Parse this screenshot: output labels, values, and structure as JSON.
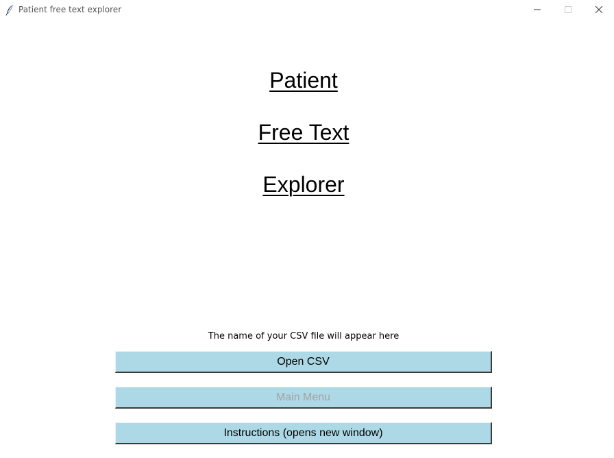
{
  "window": {
    "title": "Patient free text explorer",
    "icon": "feather-icon",
    "controls": {
      "minimize": "minimize-icon",
      "maximize": "maximize-icon",
      "close": "close-icon"
    }
  },
  "headings": {
    "line1": "Patient",
    "line2": "Free Text",
    "line3": "Explorer"
  },
  "csv_status": "The name of your CSV file will appear here",
  "buttons": {
    "open_csv": "Open CSV",
    "main_menu": "Main Menu",
    "instructions": "Instructions (opens new window)"
  },
  "button_states": {
    "main_menu_enabled": false
  },
  "colors": {
    "button_bg": "#add8e6",
    "disabled_text": "#a3a3a3"
  }
}
